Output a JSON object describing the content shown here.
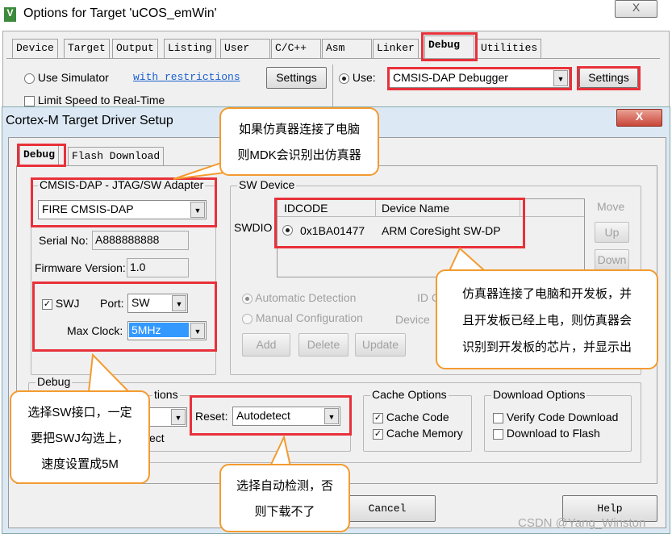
{
  "outer": {
    "title": "Options for Target 'uCOS_emWin'",
    "close": "X",
    "tabs": [
      "Device",
      "Target",
      "Output",
      "Listing",
      "User",
      "C/C++",
      "Asm",
      "Linker",
      "Debug",
      "Utilities"
    ],
    "use_simulator": "Use Simulator",
    "with_restrictions": "with restrictions",
    "settings_left": "Settings",
    "use_label": "Use:",
    "debugger": "CMSIS-DAP Debugger",
    "settings_right": "Settings",
    "limit_speed": "Limit Speed to Real-Time"
  },
  "inner": {
    "title": "Cortex-M Target Driver Setup",
    "close": "X",
    "tabs": [
      "Debug",
      "Flash Download"
    ],
    "adapter": {
      "group": "CMSIS-DAP - JTAG/SW Adapter",
      "selected": "FIRE CMSIS-DAP",
      "serial_label": "Serial No:",
      "serial": "A888888888",
      "fw_label": "Firmware Version:",
      "fw": "1.0",
      "swj": "SWJ",
      "swj_checked": true,
      "port_label": "Port:",
      "port": "SW",
      "clock_label": "Max Clock:",
      "clock": "5MHz"
    },
    "sw_device": {
      "group": "SW Device",
      "swdio": "SWDIO",
      "columns": [
        "IDCODE",
        "Device Name"
      ],
      "rows": [
        {
          "idcode": "0x1BA01477",
          "name": "ARM CoreSight SW-DP"
        }
      ],
      "move": "Move",
      "up": "Up",
      "down": "Down",
      "auto": "Automatic Detection",
      "manual": "Manual Configuration",
      "id_c": "ID C",
      "device": "Device",
      "add": "Add",
      "delete": "Delete",
      "update": "Update"
    },
    "debug": {
      "group": "Debug",
      "connect_group": "tions",
      "connect_partial": "ect",
      "reset_label": "Reset:",
      "reset": "Autodetect",
      "cache_group": "Cache Options",
      "cache_code": "Cache Code",
      "cache_memory": "Cache Memory",
      "download_group": "Download Options",
      "verify": "Verify Code Download",
      "download_flash": "Download to Flash"
    },
    "cancel": "Cancel",
    "help": "Help"
  },
  "callouts": {
    "c1": [
      "如果仿真器连接了电脑",
      "则MDK会识别出仿真器"
    ],
    "c2": [
      "仿真器连接了电脑和开发板，并",
      "且开发板已经上电，则仿真器会",
      "识别到开发板的芯片，并显示出"
    ],
    "c3": [
      "选择SW接口，一定",
      "要把SWJ勾选上，",
      "速度设置成5M"
    ],
    "c4": [
      "选择自动检测，否",
      "则下载不了"
    ]
  },
  "watermark": "CSDN @Yang_Winston",
  "colors": {
    "highlight": "#e8313a",
    "callout_border": "#f39b2f",
    "selection": "#3399ff"
  }
}
